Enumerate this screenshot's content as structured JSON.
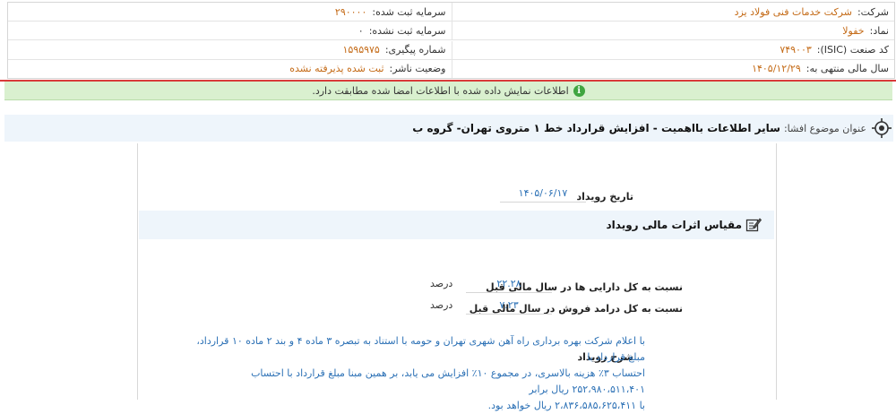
{
  "company": {
    "company_label": "شرکت:",
    "company_name": "شرکت خدمات فنی فولاد یزد",
    "capital_reg_label": "سرمایه ثبت شده:",
    "capital_reg_value": "۲۹۰۰۰۰",
    "symbol_label": "نماد:",
    "symbol_value": "خفولا",
    "capital_unreg_label": "سرمایه ثبت نشده:",
    "capital_unreg_value": "۰",
    "isic_label": "کد صنعت (ISIC):",
    "isic_value": "۷۴۹۰۰۳",
    "tracking_label": "شماره پیگیری:",
    "tracking_value": "۱۵۹۵۹۷۵",
    "fiscal_label": "سال مالی منتهی به:",
    "fiscal_value": "۱۴۰۵/۱۲/۲۹",
    "publisher_label": "وضعیت ناشر:",
    "publisher_value": "ثبت شده پذیرفته نشده"
  },
  "notice": {
    "text": "اطلاعات نمایش داده شده با اطلاعات امضا شده مطابقت دارد.",
    "icon": "info-icon",
    "bar_color": "#d9f0cf",
    "separator_color": "#d93a3a"
  },
  "subject": {
    "label": "عنوان موضوع افشا:",
    "title": "سایر اطلاعات بااهمیت - افزایش قرارداد خط ۱ متروی تهران- گروه ب"
  },
  "event_date": {
    "label": "تاریخ رویداد",
    "value": "۱۴۰۵/۰۶/۱۷"
  },
  "financial": {
    "section_title": "مقیاس اثرات مالی رویداد",
    "rows": [
      {
        "label": "نسبت به کل دارایی ها در سال مالی قبل",
        "value": "۲۲.۲۸",
        "unit": "درصد"
      },
      {
        "label": "نسبت به کل درامد فروش در سال مالی قبل",
        "value": "۷.۲۳",
        "unit": "درصد"
      }
    ]
  },
  "description": {
    "label": "شرح رویداد",
    "lines": [
      "با اعلام شرکت بهره برداری راه آهن شهری تهران و حومه با استناد به تبصره ۳ ماده ۴ و بند ۲ ماده ۱۰ قرارداد، مبلغ قرارداد با",
      "احتساب ۳٪ هزینه بالاسری، در مجموع ۱۰٪ افزایش می یابد، بر همین مبنا مبلغ قرارداد با احتساب ۲۵۲،۹۸۰،۵۱۱،۴۰۱ ریال برابر",
      "با ۲،۸۳۶،۵۸۵،۶۲۵،۴۱۱ ریال خواهد بود."
    ]
  },
  "colors": {
    "value_orange": "#c46a16",
    "value_blue": "#2b70b5",
    "panel_bg": "#eef5fb"
  }
}
